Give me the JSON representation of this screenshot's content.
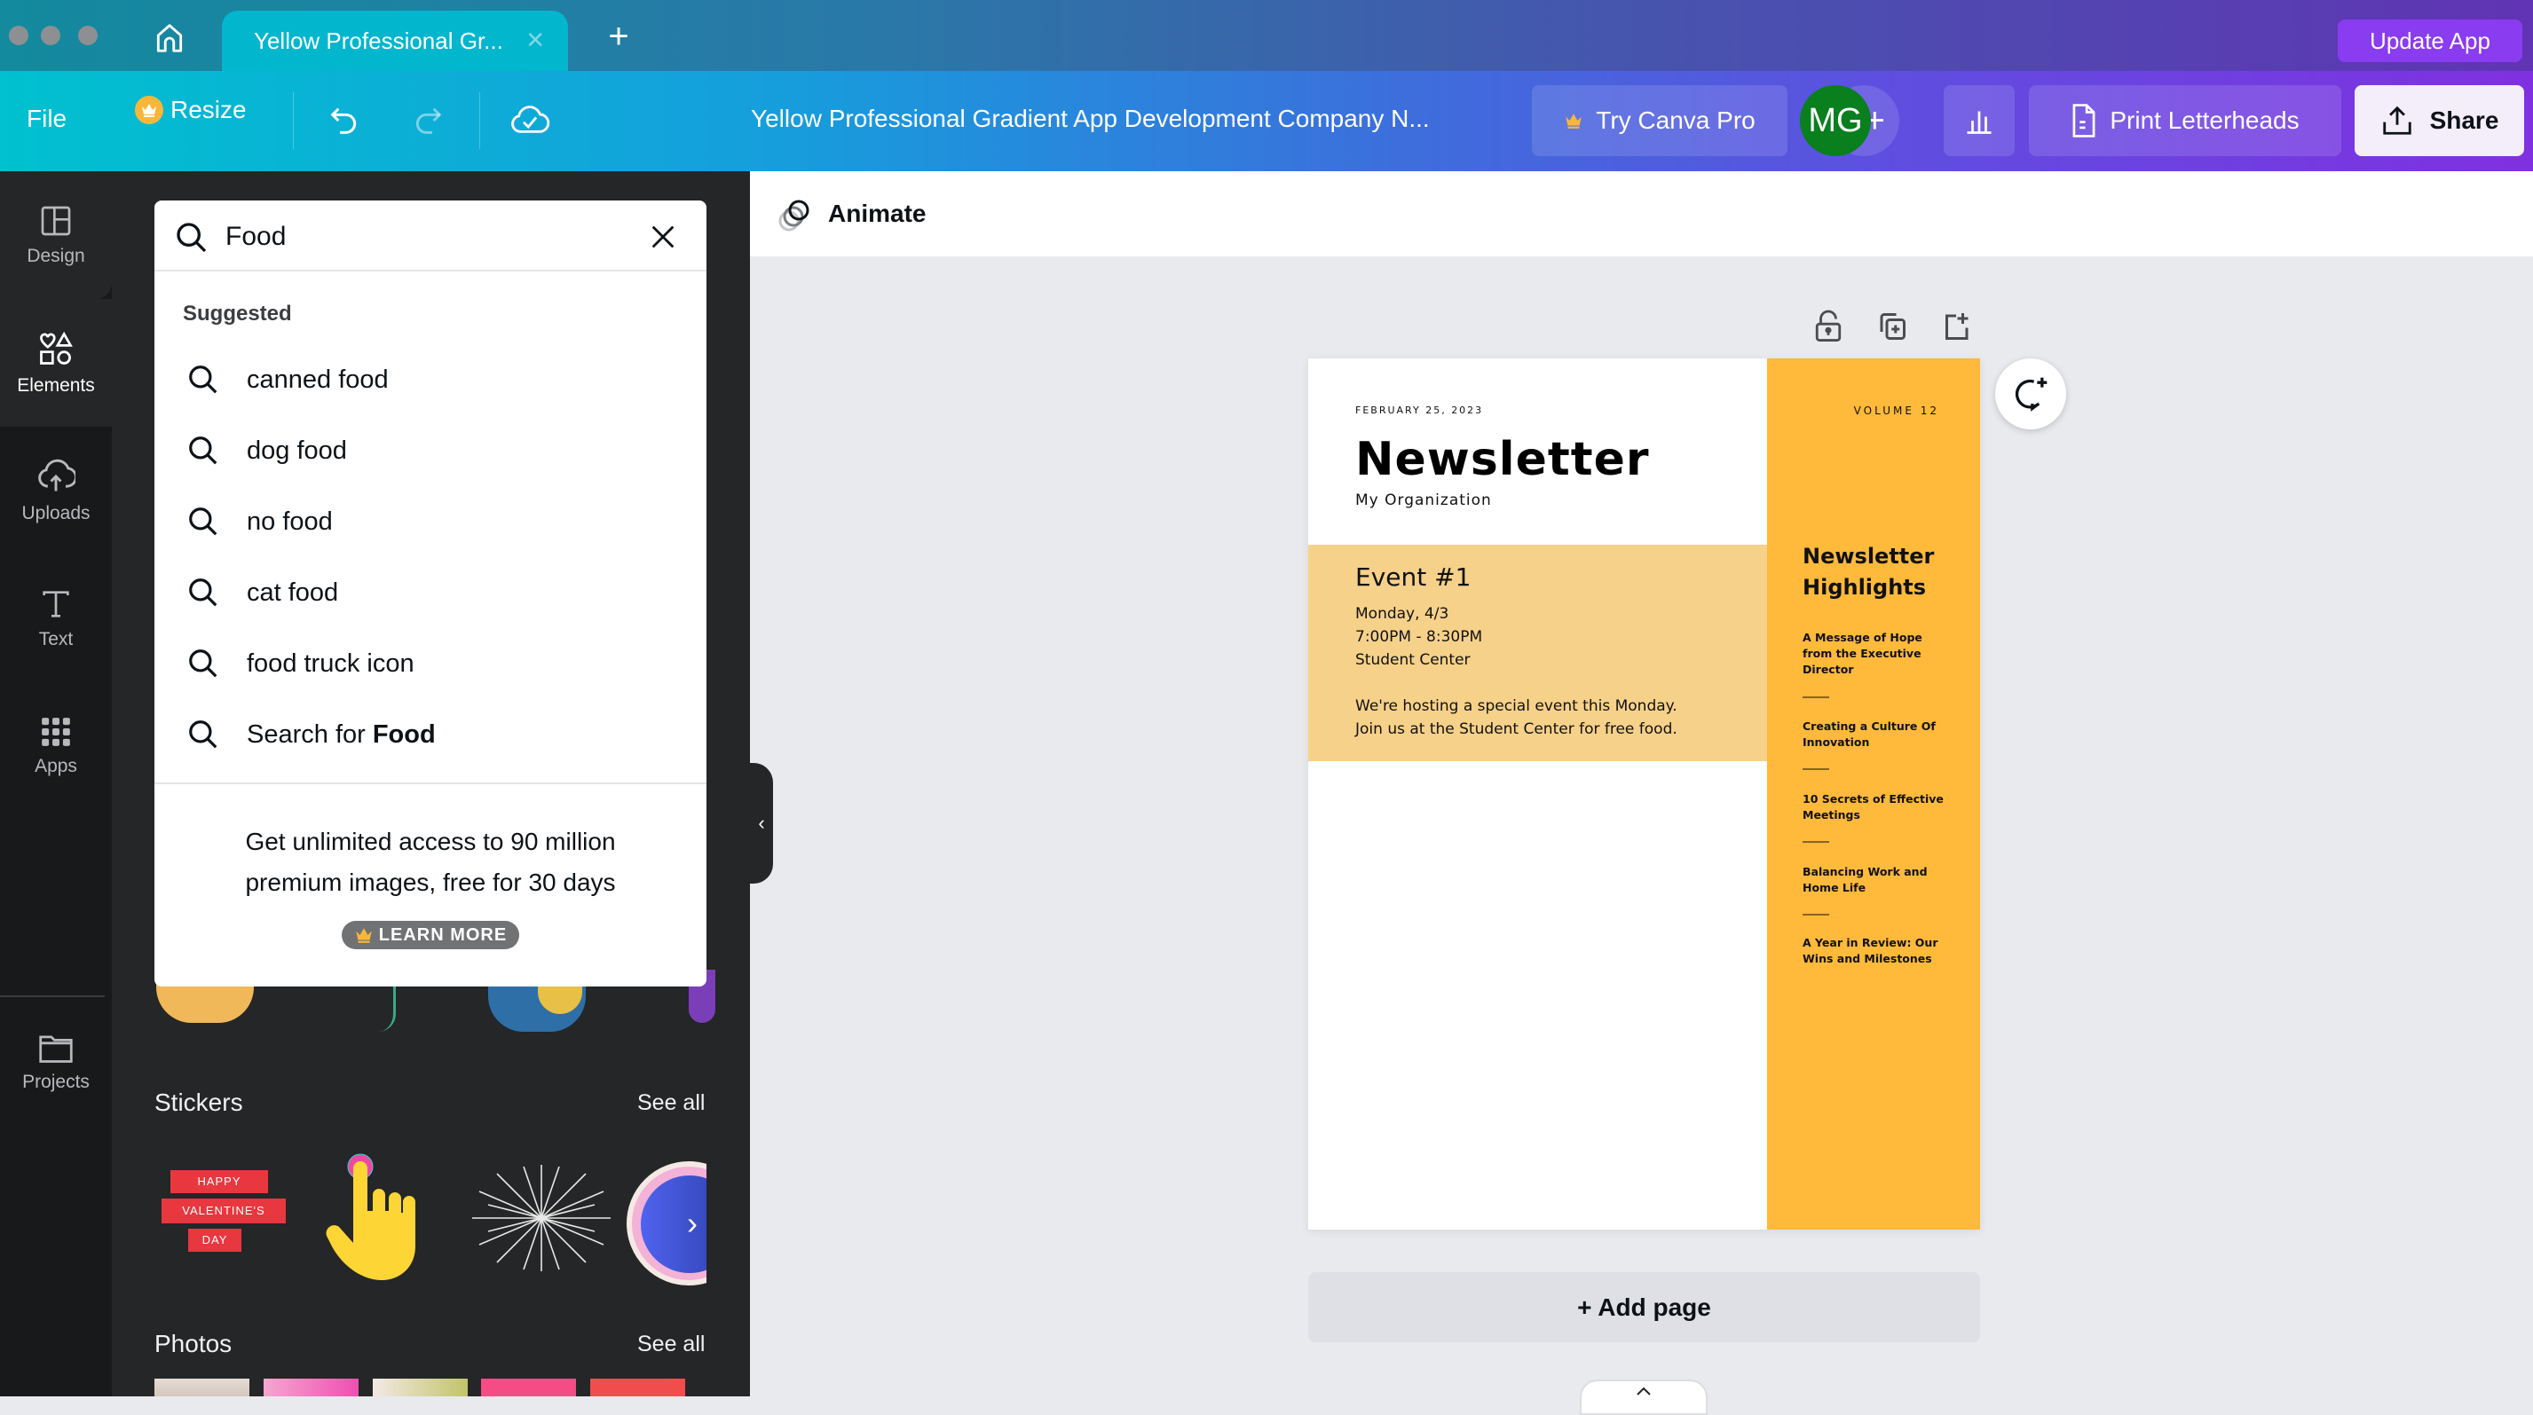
{
  "window": {
    "tab_title": "Yellow Professional Gr...",
    "update_app_label": "Update App"
  },
  "toolbar": {
    "file_label": "File",
    "resize_label": "Resize",
    "doc_title": "Yellow Professional Gradient App Development Company N...",
    "try_pro_label": "Try Canva Pro",
    "avatar_initials": "MG",
    "print_label": "Print Letterheads",
    "share_label": "Share"
  },
  "rail": {
    "items": [
      {
        "label": "Design",
        "icon": "layout-icon"
      },
      {
        "label": "Elements",
        "icon": "shapes-icon",
        "active": true
      },
      {
        "label": "Uploads",
        "icon": "cloud-upload-icon"
      },
      {
        "label": "Text",
        "icon": "text-icon"
      },
      {
        "label": "Apps",
        "icon": "apps-grid-icon"
      },
      {
        "label": "Projects",
        "icon": "folder-icon"
      }
    ]
  },
  "search": {
    "value": "Food",
    "suggested_label": "Suggested",
    "suggestions": [
      "canned food",
      "dog food",
      "no food",
      "cat food",
      "food truck icon"
    ],
    "search_for_prefix": "Search for ",
    "search_for_term": "Food",
    "promo_line1": "Get unlimited access to 90 million",
    "promo_line2": "premium images, free for 30 days",
    "learn_more_label": "LEARN MORE"
  },
  "panel": {
    "stickers_title": "Stickers",
    "stickers_see_all": "See all",
    "photos_title": "Photos",
    "photos_see_all": "See all",
    "sticker_valentine_text": [
      "HAPPY",
      "VALENTINE'S",
      "DAY"
    ]
  },
  "canvas": {
    "animate_label": "Animate",
    "add_page_label": "+ Add page"
  },
  "newsletter": {
    "date": "FEBRUARY 25, 2023",
    "title": "Newsletter",
    "organization": "My Organization",
    "volume": "VOLUME 12",
    "event_title": "Event #1",
    "event_day": "Monday, 4/3",
    "event_time": "7:00PM - 8:30PM",
    "event_location": "Student Center",
    "event_desc_1": "We're hosting a special event this Monday.",
    "event_desc_2": "Join us at the Student Center for free food.",
    "highlights_title_1": "Newsletter",
    "highlights_title_2": "Highlights",
    "highlights": [
      "A Message of Hope from the Executive Director",
      "Creating a Culture Of Innovation",
      "10 Secrets of Effective Meetings",
      "Balancing Work and Home Life",
      "A Year in Review: Our Wins and Milestones"
    ]
  },
  "colors": {
    "accent_orange": "#ffb93b",
    "event_bg": "#f6d18a",
    "avatar_green": "#097f1e",
    "update_purple": "#8a3cf0"
  }
}
